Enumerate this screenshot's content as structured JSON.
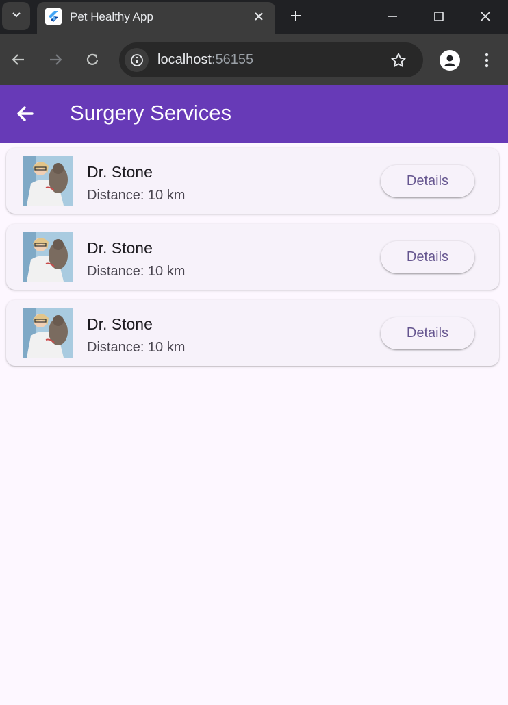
{
  "browser": {
    "tab_title": "Pet Healthy App",
    "url_host": "localhost",
    "url_port": ":56155"
  },
  "app": {
    "title": "Surgery Services",
    "color": "#673ab7"
  },
  "doctors": [
    {
      "name": "Dr. Stone",
      "distance": "Distance: 10 km",
      "button": "Details"
    },
    {
      "name": "Dr. Stone",
      "distance": "Distance: 10 km",
      "button": "Details"
    },
    {
      "name": "Dr. Stone",
      "distance": "Distance: 10 km",
      "button": "Details"
    }
  ]
}
